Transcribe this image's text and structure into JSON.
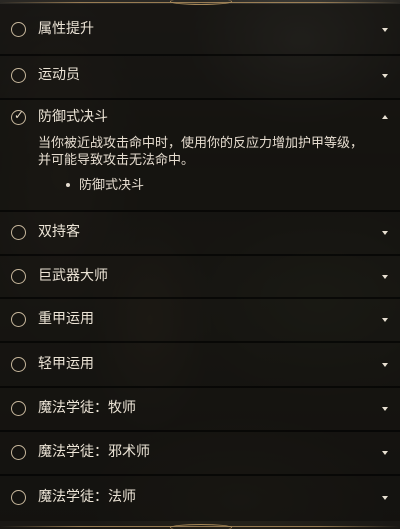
{
  "feats": [
    {
      "label": "属性提升",
      "expanded": false,
      "checked": false
    },
    {
      "label": "运动员",
      "expanded": false,
      "checked": false
    },
    {
      "label": "防御式决斗",
      "expanded": true,
      "checked": true,
      "description": "当你被近战攻击命中时，使用你的反应力增加护甲等级，并可能导致攻击无法命中。",
      "bullets": [
        "防御式决斗"
      ]
    },
    {
      "label": "双持客",
      "expanded": false,
      "checked": false
    },
    {
      "label": "巨武器大师",
      "expanded": false,
      "checked": false
    },
    {
      "label": "重甲运用",
      "expanded": false,
      "checked": false
    },
    {
      "label": "轻甲运用",
      "expanded": false,
      "checked": false
    },
    {
      "label": "魔法学徒：牧师",
      "expanded": false,
      "checked": false
    },
    {
      "label": "魔法学徒：邪术师",
      "expanded": false,
      "checked": false
    },
    {
      "label": "魔法学徒：法师",
      "expanded": false,
      "checked": false
    }
  ],
  "icons": {
    "unchecked": "radio-circle-icon",
    "checked": "checkmark-icon",
    "collapsed": "caret-down-icon",
    "expanded": "caret-up-icon"
  }
}
